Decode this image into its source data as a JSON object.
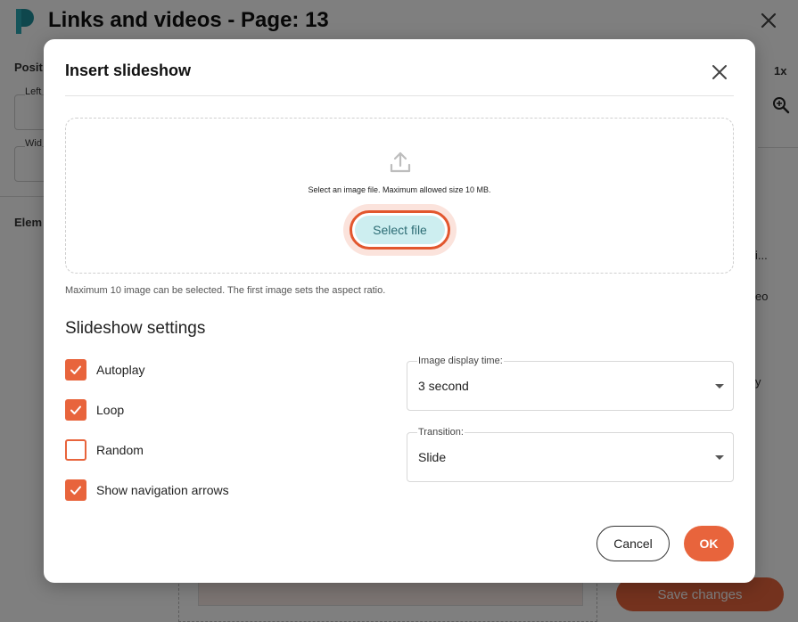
{
  "background": {
    "title": "Links and videos - Page: 13",
    "panel": {
      "position_label": "Posit",
      "left_label": "Left",
      "width_label": "Wid",
      "elements_label": "Elem",
      "zoom": "1x",
      "truncated_1": "i...",
      "truncated_2": "eo",
      "truncated_3": "y"
    },
    "save_label": "Save changes"
  },
  "modal": {
    "title": "Insert slideshow",
    "dropzone": {
      "icon": "upload-icon",
      "hint": "Select an image file. Maximum allowed size 10 MB.",
      "select_label": "Select file"
    },
    "max_note": "Maximum 10 image can be selected. The first image sets the aspect ratio.",
    "settings_title": "Slideshow settings",
    "checkboxes": [
      {
        "label": "Autoplay",
        "checked": true
      },
      {
        "label": "Loop",
        "checked": true
      },
      {
        "label": "Random",
        "checked": false
      },
      {
        "label": "Show navigation arrows",
        "checked": true
      }
    ],
    "display_time": {
      "label": "Image display time:",
      "value": "3 second"
    },
    "transition": {
      "label": "Transition:",
      "value": "Slide"
    },
    "cancel_label": "Cancel",
    "ok_label": "OK"
  },
  "colors": {
    "accent": "#e8643c",
    "select_file_bg": "#cdeef0",
    "select_file_text": "#2c6c74",
    "overlay": "rgba(0,0,0,0.5)"
  }
}
